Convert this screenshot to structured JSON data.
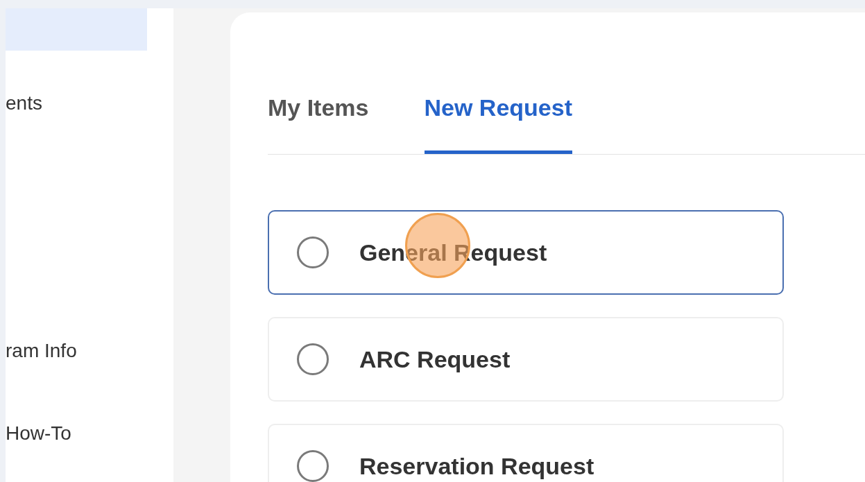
{
  "sidebar": {
    "items": [
      {
        "selected": true
      },
      {
        "label": "ents",
        "selected": false
      },
      {
        "label": "ram Info",
        "selected": false
      },
      {
        "label": "How-To",
        "selected": false
      }
    ]
  },
  "tabs": [
    {
      "label": "My Items",
      "selected": false
    },
    {
      "label": "New Request",
      "selected": true
    }
  ],
  "options": [
    {
      "label": "General Request",
      "selected": false,
      "focused": true
    },
    {
      "label": "ARC Request",
      "selected": false,
      "focused": false
    },
    {
      "label": "Reservation Request",
      "selected": false,
      "focused": false
    }
  ],
  "click_marker": {
    "on": true
  }
}
